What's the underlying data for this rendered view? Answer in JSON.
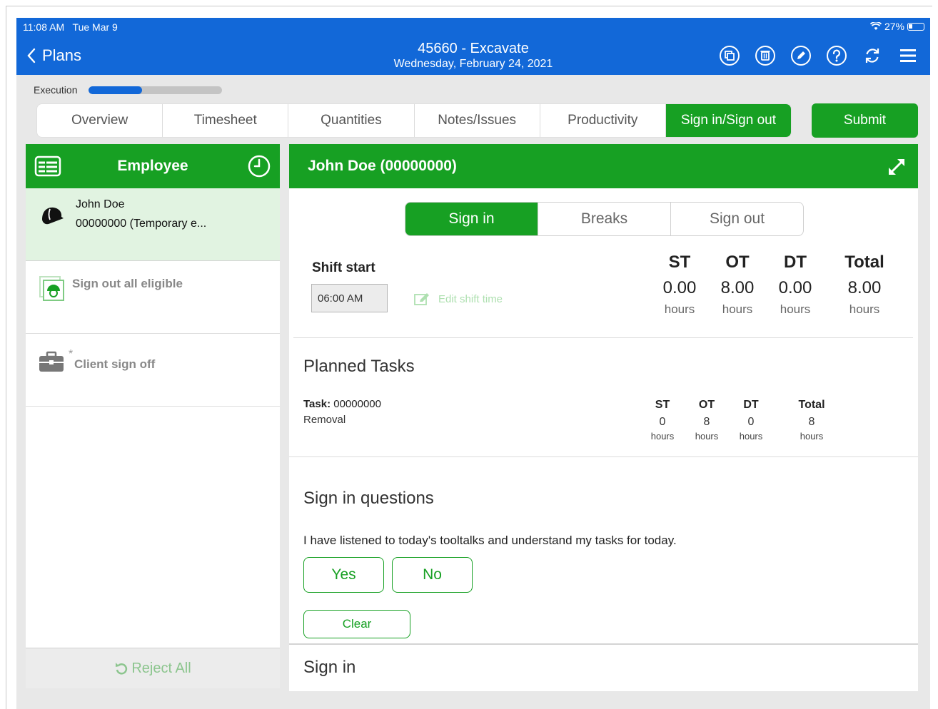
{
  "status_bar": {
    "time": "11:08 AM",
    "day": "Tue Mar 9",
    "battery": "27%"
  },
  "nav": {
    "back_label": "Plans",
    "title": "45660 - Excavate",
    "subtitle": "Wednesday, February 24, 2021",
    "icons": [
      "copy-icon",
      "trash-icon",
      "edit-pen-icon",
      "help-icon",
      "sync-icon",
      "menu-icon"
    ]
  },
  "progress": {
    "label": "Execution",
    "fraction": 0.4
  },
  "tabs": [
    {
      "label": "Overview",
      "active": false
    },
    {
      "label": "Timesheet",
      "active": false
    },
    {
      "label": "Quantities",
      "active": false
    },
    {
      "label": "Notes/Issues",
      "active": false
    },
    {
      "label": "Productivity",
      "active": false
    },
    {
      "label": "Sign in/Sign out",
      "active": true
    }
  ],
  "submit_label": "Submit",
  "left_panel": {
    "title": "Employee",
    "employee": {
      "name": "John Doe",
      "id": "00000000 (Temporary e..."
    },
    "sign_out_all": "Sign out all eligible",
    "client_sign_off_marker": "*",
    "client_sign_off": "Client sign off",
    "reject_all": "Reject All"
  },
  "right_panel": {
    "header": "John Doe (00000000)",
    "segments": [
      {
        "label": "Sign in",
        "active": true
      },
      {
        "label": "Breaks",
        "active": false
      },
      {
        "label": "Sign out",
        "active": false
      }
    ],
    "shift_start_label": "Shift start",
    "shift_start_value": "06:00 AM",
    "edit_shift_label": "Edit shift time",
    "hours": [
      {
        "key": "ST",
        "value": "0.00",
        "unit": "hours"
      },
      {
        "key": "OT",
        "value": "8.00",
        "unit": "hours"
      },
      {
        "key": "DT",
        "value": "0.00",
        "unit": "hours"
      },
      {
        "key": "Total",
        "value": "8.00",
        "unit": "hours"
      }
    ],
    "planned_tasks_title": "Planned Tasks",
    "task": {
      "label": "Task:",
      "id": "00000000",
      "description": "Removal",
      "hours": [
        {
          "key": "ST",
          "value": "0",
          "unit": "hours"
        },
        {
          "key": "OT",
          "value": "8",
          "unit": "hours"
        },
        {
          "key": "DT",
          "value": "0",
          "unit": "hours"
        },
        {
          "key": "Total",
          "value": "8",
          "unit": "hours"
        }
      ]
    },
    "questions_title": "Sign in questions",
    "question": "I have listened to today's tooltalks and understand my tasks for today.",
    "yes_label": "Yes",
    "no_label": "No",
    "clear_label": "Clear",
    "signin_footer": "Sign in"
  },
  "colors": {
    "nav_blue": "#1268d8",
    "accent_green": "#17a023",
    "selected_row": "#e1f3e1"
  }
}
